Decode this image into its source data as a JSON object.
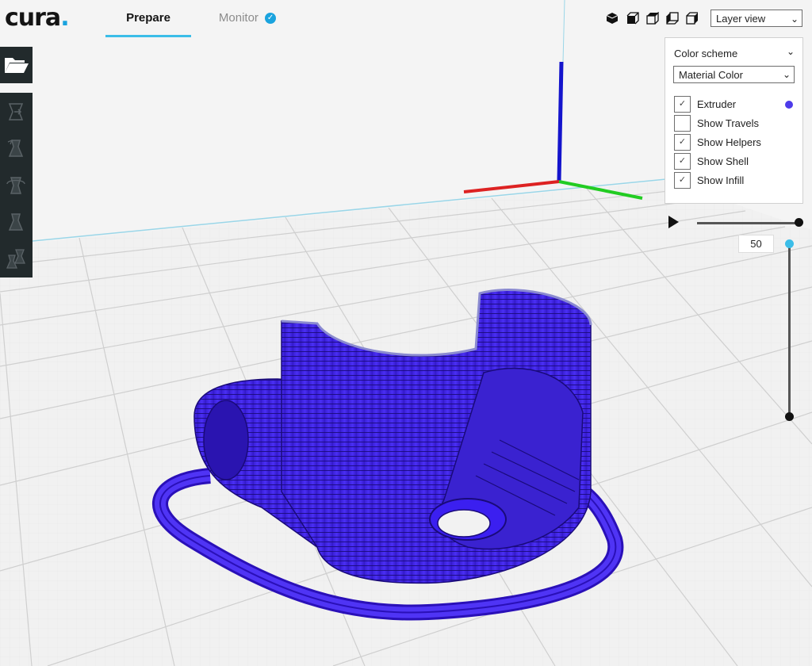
{
  "header": {
    "logo_text": "cura",
    "logo_dot": ".",
    "tabs": [
      {
        "label": "Prepare",
        "active": true
      },
      {
        "label": "Monitor",
        "active": false
      }
    ],
    "view_mode": {
      "selected": "Layer view",
      "icons": [
        "3d-view-icon",
        "front-view-icon",
        "top-view-icon",
        "left-view-icon",
        "right-view-icon"
      ]
    }
  },
  "toolbar": {
    "open_icon": "folder-open-icon",
    "tools": [
      "translate-tool-icon",
      "scale-tool-icon",
      "rotate-tool-icon",
      "mirror-tool-icon",
      "per-model-settings-icon"
    ]
  },
  "layer_panel": {
    "color_scheme_label": "Color scheme",
    "color_scheme_selected": "Material Color",
    "options": [
      {
        "label": "Extruder",
        "checked": true
      },
      {
        "label": "Show Travels",
        "checked": false
      },
      {
        "label": "Show Helpers",
        "checked": true
      },
      {
        "label": "Show Shell",
        "checked": true
      },
      {
        "label": "Show Infill",
        "checked": true
      }
    ],
    "extruder_color": "#4d3bea"
  },
  "layer_slider": {
    "current_layer": "50"
  },
  "colors": {
    "accent": "#3bbde8",
    "model": "#3b1ff0",
    "axis_x": "#e02020",
    "axis_y": "#20d020",
    "axis_z": "#1010d0",
    "toolbar_bg": "#222a2c"
  }
}
